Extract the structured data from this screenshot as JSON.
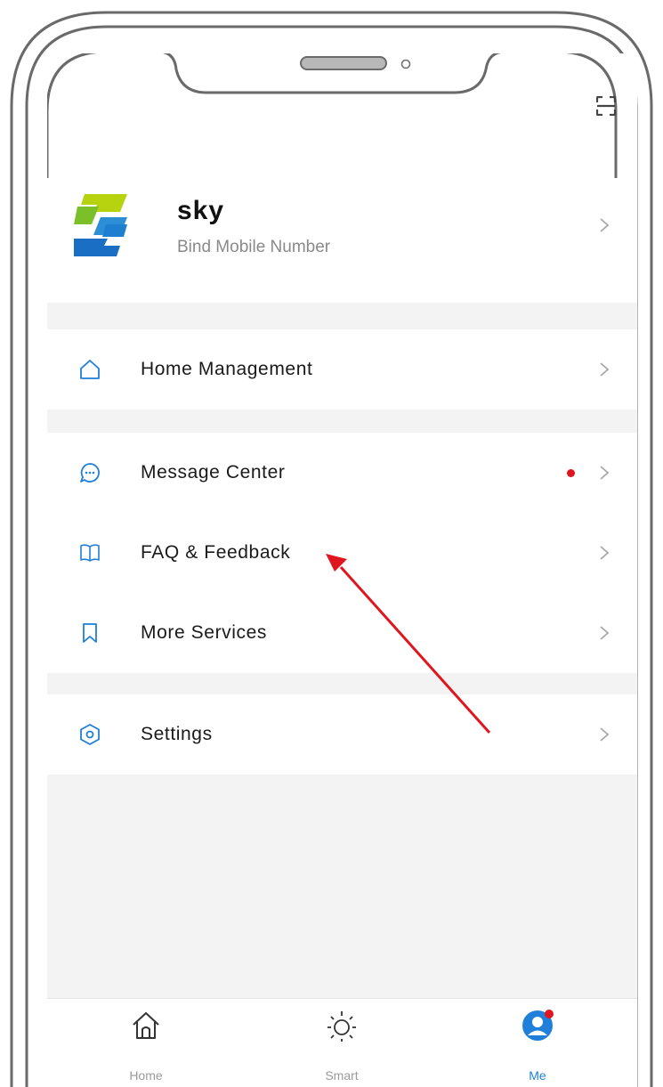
{
  "profile": {
    "name": "sky",
    "subtitle": "Bind Mobile Number"
  },
  "menu": {
    "home_management": "Home Management",
    "message_center": "Message Center",
    "faq_feedback": "FAQ & Feedback",
    "more_services": "More Services",
    "settings": "Settings"
  },
  "tabs": {
    "home": "Home",
    "smart": "Smart",
    "me": "Me"
  },
  "colors": {
    "accent": "#1f7fd9",
    "badge": "#e0161f",
    "annotation_arrow": "#e0161f"
  }
}
